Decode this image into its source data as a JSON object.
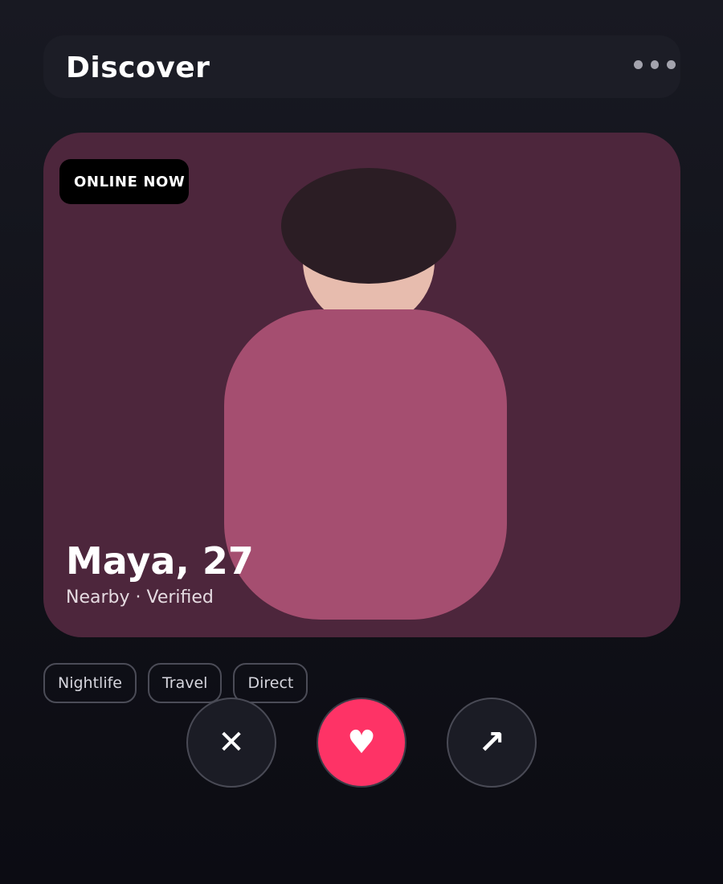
{
  "header": {
    "title": "Discover",
    "more_icon": "more-horizontal-icon"
  },
  "profile": {
    "status_badge": "ONLINE NOW",
    "name_age": "Maya, 27",
    "subtitle": "Nearby · Verified",
    "tags": [
      "Nightlife",
      "Travel",
      "Direct"
    ]
  },
  "actions": {
    "pass": {
      "icon": "close-icon",
      "glyph": "✕"
    },
    "like": {
      "icon": "heart-icon",
      "glyph": "♥"
    },
    "share": {
      "icon": "arrow-up-right-icon",
      "glyph": "↗"
    }
  },
  "colors": {
    "background": "#111219",
    "card": "#4d263c",
    "accent": "#fe3366",
    "shirt": "#a54e70",
    "hair": "#2b1d24",
    "skin": "#e7bcae"
  }
}
